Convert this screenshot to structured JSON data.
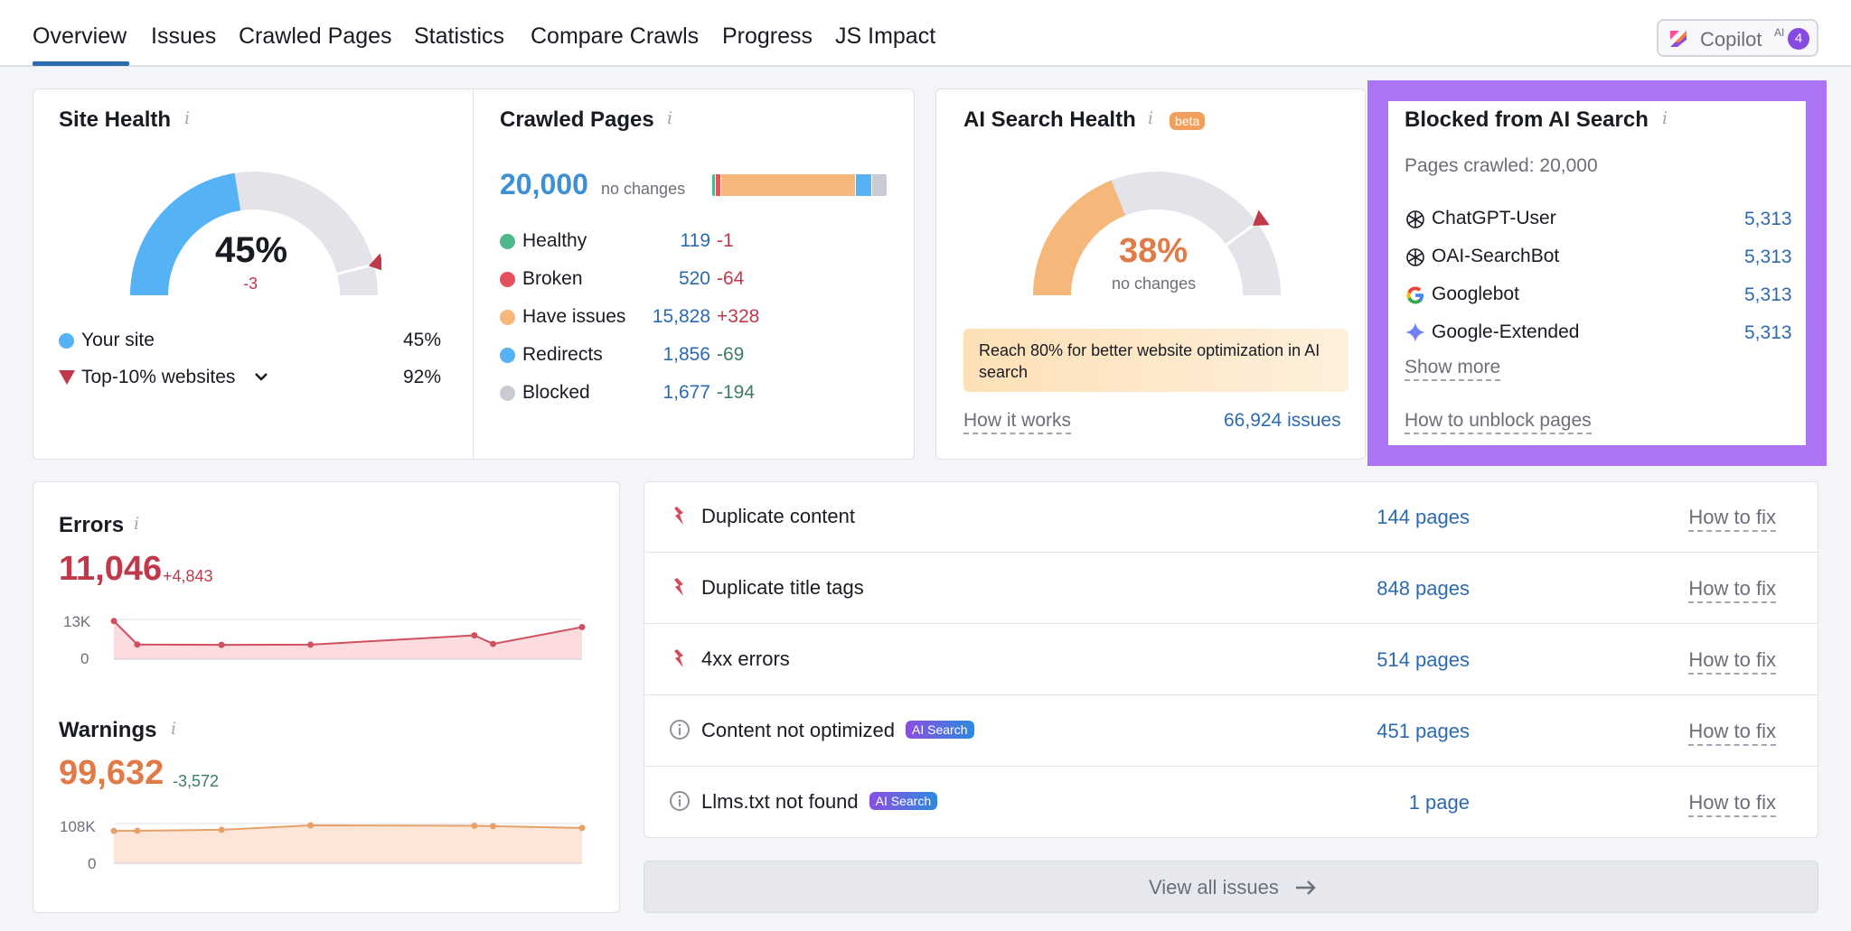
{
  "nav": {
    "tabs": [
      "Overview",
      "Issues",
      "Crawled Pages",
      "Statistics",
      "Compare Crawls",
      "Progress",
      "JS Impact"
    ],
    "active_tab": "Overview",
    "copilot": {
      "label": "Copilot",
      "sup": "AI",
      "count": "4"
    }
  },
  "site_health": {
    "title": "Site Health",
    "value": "45%",
    "delta": "-3",
    "gauge_fraction": 0.45,
    "marker_fraction": 0.92,
    "legend": [
      {
        "label": "Your site",
        "value": "45%"
      },
      {
        "label": "Top-10% websites",
        "value": "92%"
      }
    ]
  },
  "crawled_pages": {
    "title": "Crawled Pages",
    "total": "20,000",
    "total_note": "no changes",
    "rows": [
      {
        "label": "Healthy",
        "value": "119",
        "delta": "-1",
        "color": "#4fb88b"
      },
      {
        "label": "Broken",
        "value": "520",
        "delta": "-64",
        "color": "#e5505d"
      },
      {
        "label": "Have issues",
        "value": "15,828",
        "delta": "+328",
        "color": "#f5b87a"
      },
      {
        "label": "Redirects",
        "value": "1,856",
        "delta": "-69",
        "color": "#55b2f5"
      },
      {
        "label": "Blocked",
        "value": "1,677",
        "delta": "-194",
        "color": "#c9cbd2"
      }
    ]
  },
  "ai_search_health": {
    "title": "AI Search Health",
    "badge": "beta",
    "value": "38%",
    "note": "no changes",
    "gauge_fraction": 0.38,
    "marker_fraction": 0.8,
    "tip": "Reach 80% for better website optimization in AI search",
    "how_it_works": "How it works",
    "issues_link": "66,924 issues"
  },
  "blocked_ai": {
    "title": "Blocked from AI Search",
    "pages_crawled": "Pages crawled: 20,000",
    "bots": [
      {
        "name": "ChatGPT-User",
        "value": "5,313",
        "icon": "openai-icon"
      },
      {
        "name": "OAI-SearchBot",
        "value": "5,313",
        "icon": "openai-icon"
      },
      {
        "name": "Googlebot",
        "value": "5,313",
        "icon": "google-icon"
      },
      {
        "name": "Google-Extended",
        "value": "5,313",
        "icon": "gemini-icon"
      }
    ],
    "show_more": "Show more",
    "how_to_unblock": "How to unblock pages"
  },
  "errors": {
    "title": "Errors",
    "value": "11,046",
    "delta": "+4,843",
    "y_max_label": "13K",
    "y_min_label": "0",
    "y_max": 13000,
    "points": [
      12500,
      4800,
      4700,
      4750,
      7800,
      5000,
      10500
    ]
  },
  "warnings": {
    "title": "Warnings",
    "value": "99,632",
    "delta": "-3,572",
    "y_max_label": "108K",
    "y_min_label": "0",
    "y_max": 108000,
    "points": [
      88000,
      88500,
      91000,
      103000,
      102000,
      101000,
      96000
    ]
  },
  "issues": [
    {
      "label": "Duplicate content",
      "pages": "144 pages",
      "fix": "How to fix",
      "type": "error",
      "badge": ""
    },
    {
      "label": "Duplicate title tags",
      "pages": "848 pages",
      "fix": "How to fix",
      "type": "error",
      "badge": ""
    },
    {
      "label": "4xx errors",
      "pages": "514 pages",
      "fix": "How to fix",
      "type": "error",
      "badge": ""
    },
    {
      "label": "Content not optimized",
      "pages": "451 pages",
      "fix": "How to fix",
      "type": "notice",
      "badge": "AI Search"
    },
    {
      "label": "Llms.txt not found",
      "pages": "1 page",
      "fix": "How to fix",
      "type": "notice",
      "badge": "AI Search"
    }
  ],
  "view_all": "View all issues",
  "colors": {
    "accent_blue": "#2c6ab0",
    "gauge_blue": "#55b2f5",
    "gauge_orange": "#f5b87a",
    "error_red": "#c0394b",
    "warning_orange": "#e07a47",
    "highlight_purple": "#ad75f5"
  }
}
